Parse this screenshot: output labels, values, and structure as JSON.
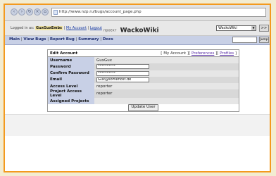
{
  "browser": {
    "url": "http://www.nzp.ru/bugs/account_page.php"
  },
  "header": {
    "logged_in_as": "Logged in as:",
    "user": "GuxGuxEmbs",
    "sep1": " | ",
    "my_account": "My Account",
    "sep2": " | ",
    "logout": "Logout",
    "logo_small": "проект",
    "logo_big": "WackoWiki",
    "project_select": "WackoWiki",
    "switch_label": ">>"
  },
  "menu": {
    "items": [
      "Main",
      "View Bugs",
      "Report Bug",
      "Summary",
      "Docs"
    ],
    "separator": " | ",
    "jump_label": "Jump"
  },
  "form": {
    "title": "Edit Account",
    "links_prefix": "[ ",
    "link_my_account": "My Account",
    "link_sep": " ][ ",
    "link_preferences": "Preferences",
    "link_profiles": "Profiles",
    "links_suffix": " ]",
    "rows": {
      "username_label": "Username",
      "username_value": "GuxGux",
      "password_label": "Password",
      "password_value": "**********",
      "confirm_label": "Confirm Password",
      "confirm_value": "**********",
      "email_label": "Email",
      "email_value": "Gux@somehost.de",
      "access_label": "Access Level",
      "access_value": "reporter",
      "project_access_label": "Project Access Level",
      "project_access_value": "reporter",
      "assigned_label": "Assigned Projects",
      "assigned_value": ""
    },
    "submit_label": "Update User"
  }
}
